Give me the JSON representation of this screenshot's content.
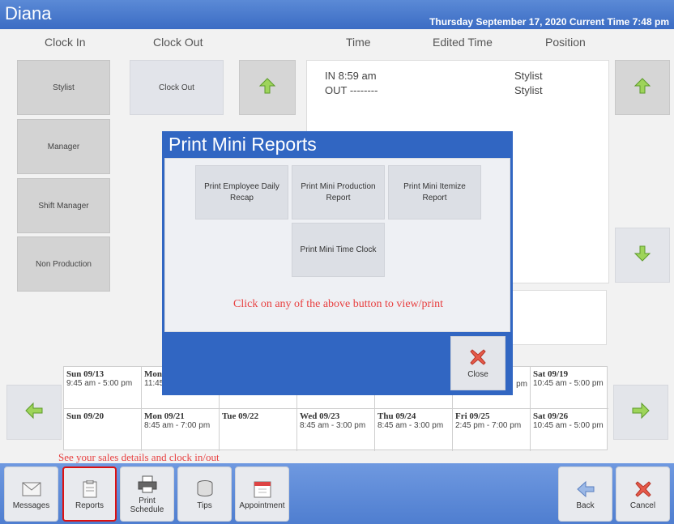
{
  "header": {
    "user_name": "Diana",
    "datetime": "Thursday September 17, 2020 Current Time 7:48 pm"
  },
  "columns": {
    "clock_in": "Clock In",
    "clock_out": "Clock Out",
    "time": "Time",
    "edited_time": "Edited Time",
    "position": "Position"
  },
  "positions": [
    "Stylist",
    "Manager",
    "Shift Manager",
    "Non Production"
  ],
  "clock_out_button": "Clock Out",
  "time_records": [
    {
      "time": "IN 8:59 am",
      "position": "Stylist"
    },
    {
      "time": "OUT --------",
      "position": "Stylist"
    }
  ],
  "schedule": {
    "week1": [
      {
        "day": "Sun 09/13",
        "hours": "9:45 am - 5:00 pm"
      },
      {
        "day": "Mon",
        "hours": "11:45"
      },
      {
        "day": "Sat 09/19",
        "hours": "10:45 am - 5:00 pm"
      }
    ],
    "week1_partial": {
      "day": "",
      "hours": "pm"
    },
    "week2": [
      {
        "day": "Sun 09/20",
        "hours": ""
      },
      {
        "day": "Mon 09/21",
        "hours": "8:45 am - 7:00 pm"
      },
      {
        "day": "Tue 09/22",
        "hours": ""
      },
      {
        "day": "Wed 09/23",
        "hours": "8:45 am - 3:00 pm"
      },
      {
        "day": "Thu 09/24",
        "hours": "8:45 am - 3:00 pm"
      },
      {
        "day": "Fri 09/25",
        "hours": "2:45 pm - 7:00 pm"
      },
      {
        "day": "Sat 09/26",
        "hours": "10:45 am - 5:00 pm"
      }
    ]
  },
  "hint_text": "See your sales details and clock in/out",
  "bottom_buttons": {
    "messages": "Messages",
    "reports": "Reports",
    "print_schedule": "Print Schedule",
    "tips": "Tips",
    "appointment": "Appointment",
    "back": "Back",
    "cancel": "Cancel"
  },
  "modal": {
    "title": "Print Mini Reports",
    "buttons": {
      "employee_daily_recap": "Print Employee Daily Recap",
      "mini_production": "Print Mini Production Report",
      "mini_itemize": "Print Mini Itemize Report",
      "mini_time_clock": "Print Mini Time Clock"
    },
    "message": "Click on any of the above button to view/print",
    "close": "Close"
  },
  "icons": {
    "up": "arrow-up-icon",
    "down": "arrow-down-icon",
    "left": "arrow-left-icon",
    "right": "arrow-right-icon",
    "close": "close-x-icon"
  },
  "colors": {
    "brand_blue": "#3166c2",
    "hint_red": "#e84040",
    "arrow_green": "#7cc242"
  }
}
